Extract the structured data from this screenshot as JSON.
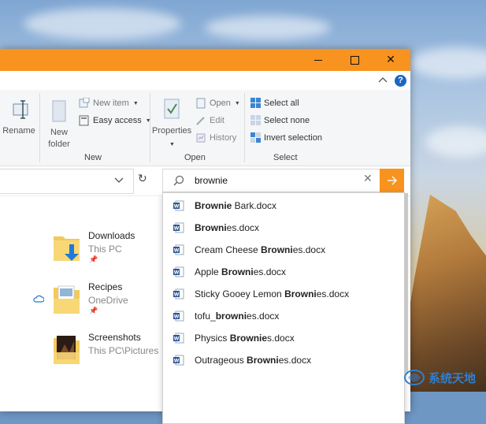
{
  "window": {
    "accent": "#f7931e",
    "buttons": {
      "minimize": "minimize",
      "maximize": "maximize",
      "close": "✕"
    }
  },
  "ribbon": {
    "rename": "Rename",
    "new_folder_line1": "New",
    "new_folder_line2": "folder",
    "new_item": "New item",
    "easy_access": "Easy access",
    "new_group": "New",
    "properties": "Properties",
    "open": "Open",
    "edit": "Edit",
    "history": "History",
    "open_group": "Open",
    "select_all": "Select all",
    "select_none": "Select none",
    "invert_selection": "Invert selection",
    "select_group": "Select"
  },
  "help": "?",
  "search": {
    "value": "brownie"
  },
  "suggestions": [
    {
      "bold": "Brownie",
      "rest": " Bark.docx",
      "pre": ""
    },
    {
      "bold": "Browni",
      "rest": "es.docx",
      "pre": ""
    },
    {
      "pre": "Cream Cheese ",
      "bold": "Browni",
      "rest": "es.docx"
    },
    {
      "pre": "Apple ",
      "bold": "Browni",
      "rest": "es.docx"
    },
    {
      "pre": "Sticky Gooey Lemon ",
      "bold": "Browni",
      "rest": "es.docx"
    },
    {
      "pre": "tofu_",
      "bold": "browni",
      "rest": "es.docx"
    },
    {
      "pre": "Physics ",
      "bold": "Brownie",
      "rest": "s.docx"
    },
    {
      "pre": "Outrageous ",
      "bold": "Browni",
      "rest": "es.docx"
    }
  ],
  "quick_access": [
    {
      "name": "Downloads",
      "location": "This PC",
      "pinned": true,
      "cloud": false
    },
    {
      "name": "Recipes",
      "location": "OneDrive",
      "pinned": true,
      "cloud": true
    },
    {
      "name": "Screenshots",
      "location": "This PC\\Pictures",
      "pinned": false,
      "cloud": false
    }
  ],
  "watermark": {
    "text": "系统天地"
  }
}
